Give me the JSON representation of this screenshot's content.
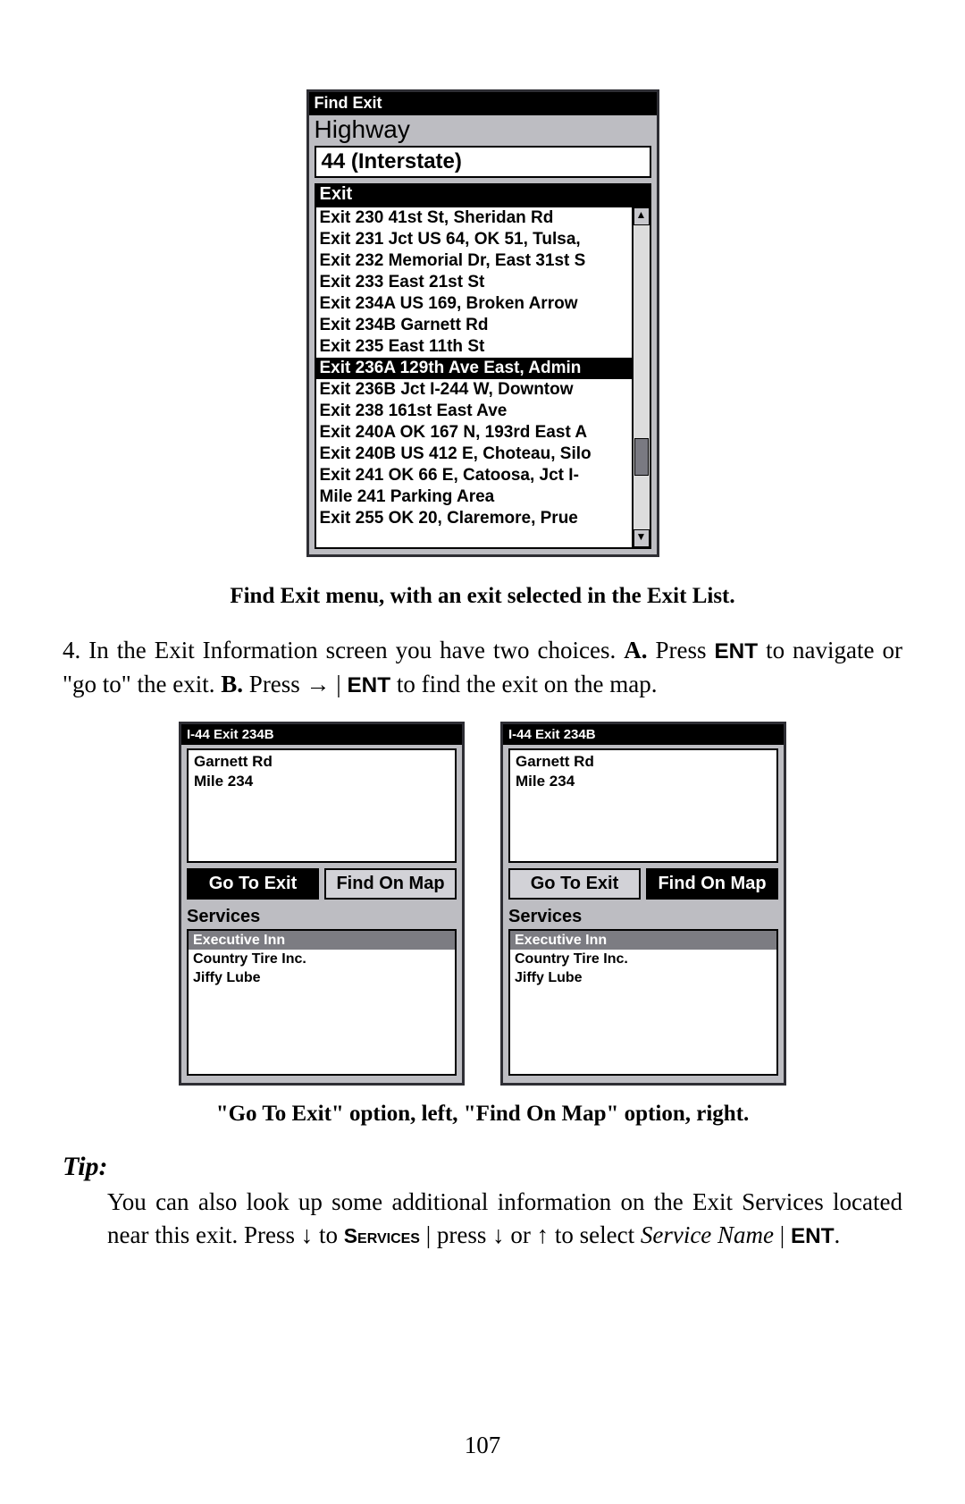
{
  "find_exit": {
    "title": "Find Exit",
    "highway_label": "Highway",
    "highway_value": "44 (Interstate)",
    "exit_header": "Exit",
    "items": [
      "Exit 230 41st St, Sheridan Rd",
      "Exit 231 Jct US 64, OK 51, Tulsa,",
      "Exit 232 Memorial Dr, East 31st S",
      "Exit 233 East 21st St",
      "Exit 234A US 169, Broken Arrow",
      "Exit 234B Garnett Rd",
      "Exit 235 East 11th St",
      "Exit 236A 129th Ave East, Admin",
      "Exit 236B Jct I-244 W, Downtow",
      "Exit 238 161st East Ave",
      "Exit 240A OK 167 N, 193rd East A",
      "Exit 240B US 412 E, Choteau, Silo",
      "Exit 241 OK 66 E, Catoosa, Jct I-",
      "Mile 241 Parking Area",
      "Exit 255 OK 20, Claremore, Prue"
    ],
    "selected_index": 7
  },
  "caption1": "Find Exit menu, with an exit selected in the Exit List.",
  "step4": {
    "prefix": "4. In the Exit Information screen you have two choices. ",
    "a_label": "A.",
    "a_text": " Press ",
    "ent": "ENT",
    "a_after": " to navigate or \"go to\" the exit. ",
    "b_label": "B.",
    "b_text": " Press → | ",
    "b_after": " to find the exit on the map."
  },
  "exit_info": {
    "title": "I-44 Exit 234B",
    "line1": "Garnett Rd",
    "line2": "Mile 234",
    "btn_goto": "Go To Exit",
    "btn_find": "Find On Map",
    "services_label": "Services",
    "services": [
      "Executive Inn",
      "Country Tire Inc.",
      "Jiffy Lube"
    ]
  },
  "caption2": "\"Go To Exit\" option, left, \"Find On Map\" option, right.",
  "tip": {
    "heading": "Tip:",
    "t1": "You can also look up some additional information on the Exit Services located near this exit. Press ↓ to ",
    "services_sc": "Services",
    "t2": " | press ↓ or ↑ to select ",
    "service_name_it": "Service Name",
    "t3": " | ",
    "ent": "ENT",
    "t4": "."
  },
  "page_number": "107"
}
